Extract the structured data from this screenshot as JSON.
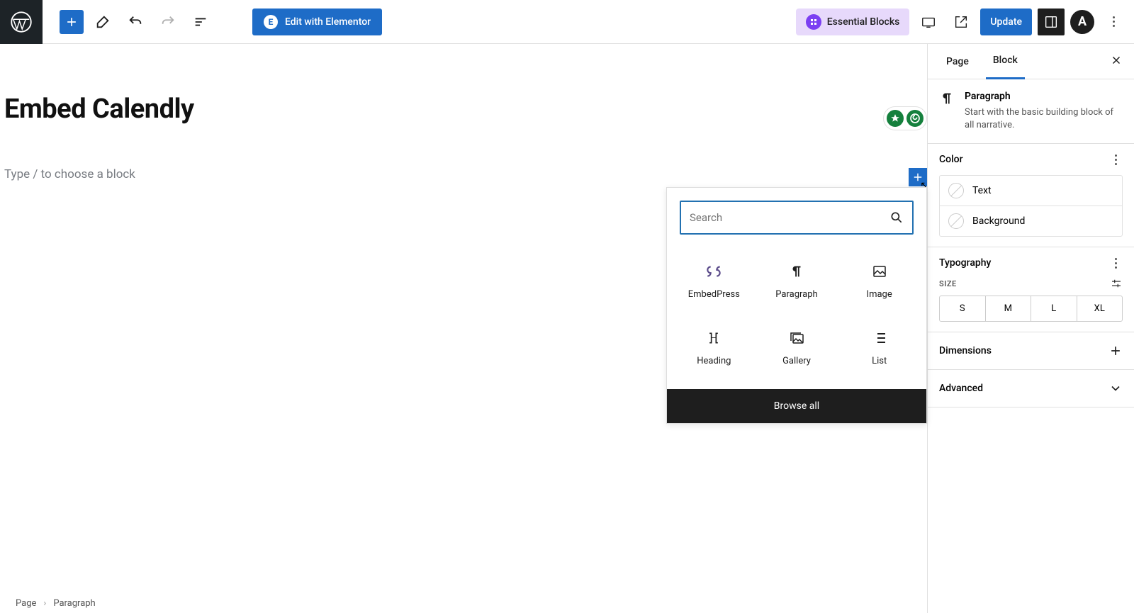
{
  "toolbar": {
    "elementor_label": "Edit with Elementor",
    "essential_blocks_label": "Essential Blocks",
    "update_label": "Update",
    "astra_label": "A"
  },
  "page": {
    "title": "Embed Calendly",
    "placeholder": "Type / to choose a block"
  },
  "inserter": {
    "search_placeholder": "Search",
    "blocks": [
      {
        "label": "EmbedPress"
      },
      {
        "label": "Paragraph"
      },
      {
        "label": "Image"
      },
      {
        "label": "Heading"
      },
      {
        "label": "Gallery"
      },
      {
        "label": "List"
      }
    ],
    "browse_all": "Browse all"
  },
  "sidebar": {
    "tabs": {
      "page": "Page",
      "block": "Block"
    },
    "block": {
      "name": "Paragraph",
      "description": "Start with the basic building block of all narrative."
    },
    "color": {
      "title": "Color",
      "text_label": "Text",
      "background_label": "Background"
    },
    "typography": {
      "title": "Typography",
      "size_label": "SIZE",
      "sizes": [
        "S",
        "M",
        "L",
        "XL"
      ]
    },
    "dimensions": {
      "title": "Dimensions"
    },
    "advanced": {
      "title": "Advanced"
    }
  },
  "breadcrumb": {
    "root": "Page",
    "current": "Paragraph"
  }
}
